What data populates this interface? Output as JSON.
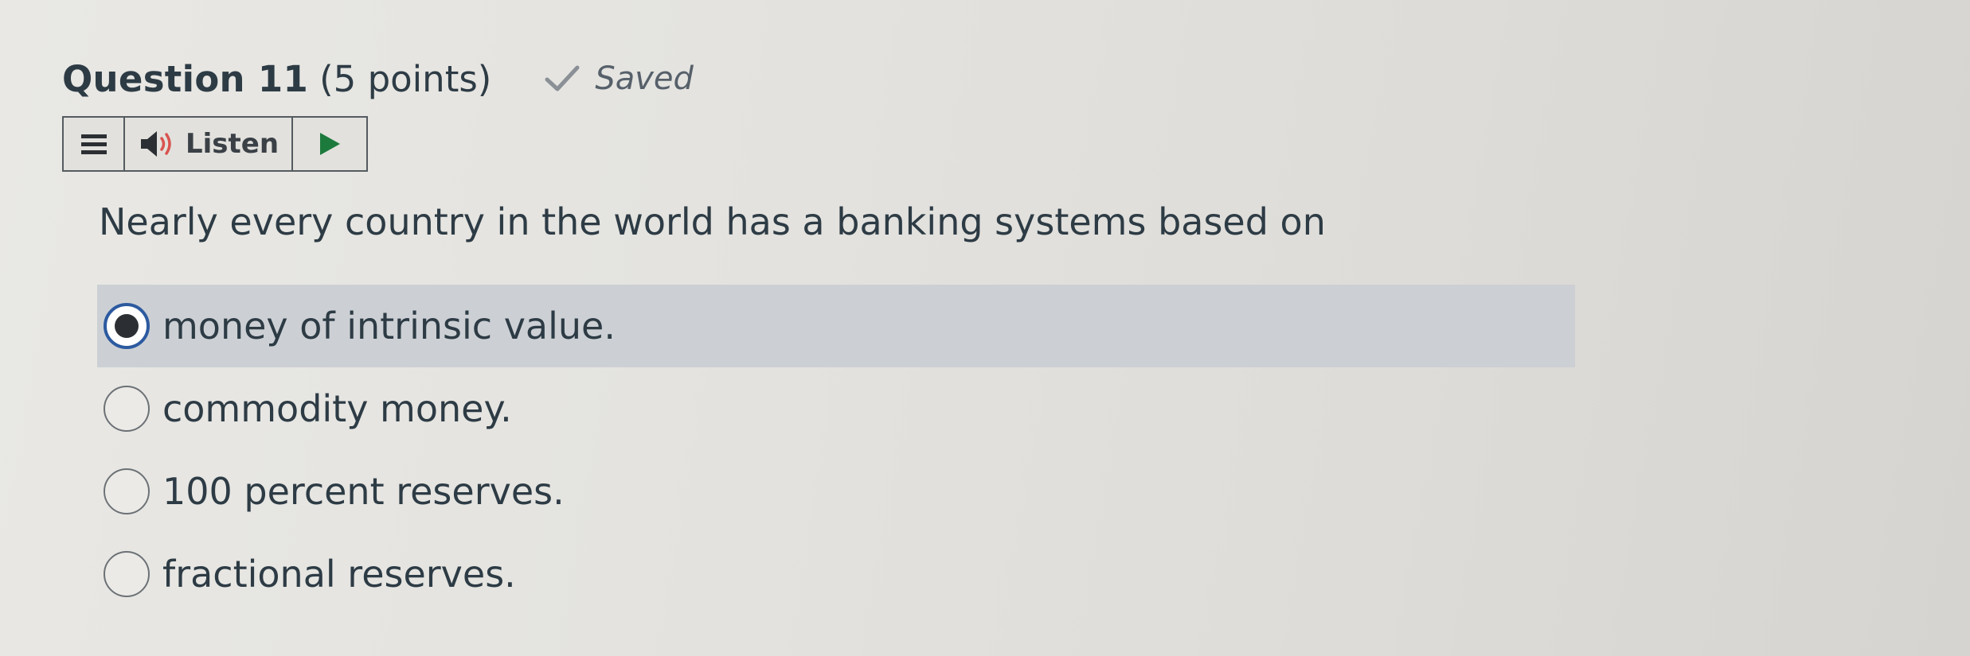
{
  "question": {
    "title": "Question 11",
    "points": "(5 points)",
    "saved_label": "Saved",
    "text": "Nearly every country in the world has a banking systems based on"
  },
  "listen_toolbar": {
    "label": "Listen",
    "icons": [
      "menu-icon",
      "speaker-icon",
      "play-icon"
    ]
  },
  "options": [
    {
      "label": "money of intrinsic value.",
      "selected": true
    },
    {
      "label": "commodity money.",
      "selected": false
    },
    {
      "label": "100 percent reserves.",
      "selected": false
    },
    {
      "label": "fractional reserves.",
      "selected": false
    }
  ],
  "colors": {
    "text": "#2d3b45",
    "selected_background": "#ccd0d4",
    "radio_selected_ring": "#2c5aa0",
    "play_icon": "#1c7a3c",
    "check_icon": "#8a9096"
  }
}
